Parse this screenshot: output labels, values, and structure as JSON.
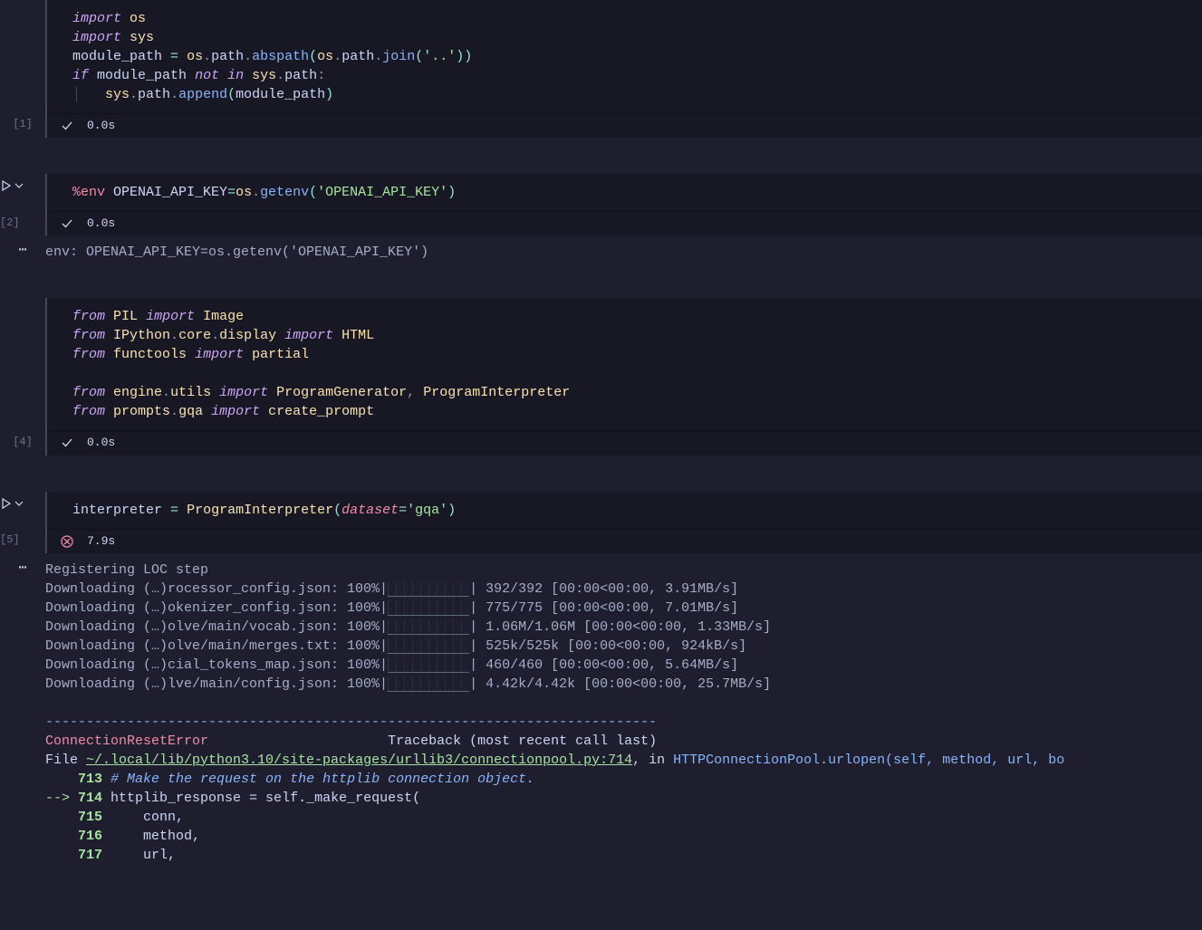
{
  "cells": [
    {
      "exec": "[1]",
      "status": "ok",
      "time": "0.0s",
      "code_html": "<span class='kw'>import</span> <span class='mod'>os</span>\n<span class='kw'>import</span> <span class='mod'>sys</span>\n<span class='var'>module_path</span> <span class='op'>=</span> <span class='mod'>os</span><span class='punc'>.</span><span class='var'>path</span><span class='punc'>.</span><span class='func'>abspath</span><span class='op'>(</span><span class='mod'>os</span><span class='punc'>.</span><span class='var'>path</span><span class='punc'>.</span><span class='func'>join</span><span class='op'>(</span><span class='str'>'..'</span><span class='op'>)</span><span class='op'>)</span>\n<span class='kw'>if</span> <span class='var'>module_path</span> <span class='kw'>not</span> <span class='kw'>in</span> <span class='mod'>sys</span><span class='punc'>.</span><span class='var'>path</span><span class='punc'>:</span>\n<span class='guide'>│   </span><span class='mod'>sys</span><span class='punc'>.</span><span class='var'>path</span><span class='punc'>.</span><span class='func'>append</span><span class='op'>(</span><span class='var'>module_path</span><span class='op'>)</span>"
    },
    {
      "exec": "[2]",
      "status": "ok",
      "time": "0.0s",
      "run_controls": true,
      "code_html": "<span class='magic'>%env</span> <span class='var'>OPENAI_API_KEY</span><span class='op'>=</span><span class='mod'>os</span><span class='punc'>.</span><span class='func'>getenv</span><span class='op'>(</span><span class='str'>'OPENAI_API_KEY'</span><span class='op'>)</span>",
      "output": "env: OPENAI_API_KEY=os.getenv('OPENAI_API_KEY')"
    },
    {
      "exec": "[4]",
      "status": "ok",
      "time": "0.0s",
      "code_html": "<span class='kw'>from</span> <span class='mod'>PIL</span> <span class='kw'>import</span> <span class='mod'>Image</span>\n<span class='kw'>from</span> <span class='mod'>IPython</span><span class='punc'>.</span><span class='mod'>core</span><span class='punc'>.</span><span class='mod'>display</span> <span class='kw'>import</span> <span class='mod'>HTML</span>\n<span class='kw'>from</span> <span class='mod'>functools</span> <span class='kw'>import</span> <span class='mod'>partial</span>\n\n<span class='kw'>from</span> <span class='mod'>engine</span><span class='punc'>.</span><span class='mod'>utils</span> <span class='kw'>import</span> <span class='mod'>ProgramGenerator</span><span class='punc'>,</span> <span class='mod'>ProgramInterpreter</span>\n<span class='kw'>from</span> <span class='mod'>prompts</span><span class='punc'>.</span><span class='mod'>gqa</span> <span class='kw'>import</span> <span class='mod'>create_prompt</span>"
    },
    {
      "exec": "[5]",
      "status": "err",
      "time": "7.9s",
      "run_controls": true,
      "code_html": "<span class='var'>interpreter</span> <span class='op'>=</span> <span class='cls'>ProgramInterpreter</span><span class='op'>(</span><span class='param'>dataset</span><span class='op'>=</span><span class='str'>'gqa'</span><span class='op'>)</span>",
      "output_rich": true
    }
  ],
  "cell5_output": {
    "registering": "Registering LOC step",
    "downloads": [
      "Downloading (…)rocessor_config.json: 100%|██████████| 392/392 [00:00<00:00, 3.91MB/s]",
      "Downloading (…)okenizer_config.json: 100%|██████████| 775/775 [00:00<00:00, 7.01MB/s]",
      "Downloading (…)olve/main/vocab.json: 100%|██████████| 1.06M/1.06M [00:00<00:00, 1.33MB/s]",
      "Downloading (…)olve/main/merges.txt: 100%|██████████| 525k/525k [00:00<00:00, 924kB/s]",
      "Downloading (…)cial_tokens_map.json: 100%|██████████| 460/460 [00:00<00:00, 5.64MB/s]",
      "Downloading (…)lve/main/config.json: 100%|██████████| 4.42k/4.42k [00:00<00:00, 25.7MB/s]"
    ],
    "tb_dash": "---------------------------------------------------------------------------",
    "tb_error": "ConnectionResetError",
    "tb_header_rest": "                      Traceback (most recent call last)",
    "tb_file_prefix": "File ",
    "tb_file_path": "~/.local/lib/python3.10/site-packages/urllib3/connectionpool.py:714",
    "tb_file_suffix": ", in ",
    "tb_call": "HTTPConnectionPool.urlopen(self, method, url, bo",
    "tb_lines": [
      {
        "no": "713",
        "prefix": "    ",
        "text": " # Make the request on the httplib connection object.",
        "comment": true
      },
      {
        "no": "714",
        "prefix": "--> ",
        "text": " httplib_response = self._make_request(",
        "arrow": true
      },
      {
        "no": "715",
        "prefix": "    ",
        "text": "     conn,"
      },
      {
        "no": "716",
        "prefix": "    ",
        "text": "     method,"
      },
      {
        "no": "717",
        "prefix": "    ",
        "text": "     url,"
      }
    ]
  },
  "chart_data": {
    "type": "bar",
    "note": "Download progress bars (all 100%)",
    "categories": [
      "rocessor_config.json",
      "okenizer_config.json",
      "vocab.json",
      "merges.txt",
      "special_tokens_map.json",
      "config.json"
    ],
    "values": [
      100,
      100,
      100,
      100,
      100,
      100
    ],
    "sizes": [
      "392/392",
      "775/775",
      "1.06M/1.06M",
      "525k/525k",
      "460/460",
      "4.42k/4.42k"
    ],
    "rates": [
      "3.91MB/s",
      "7.01MB/s",
      "1.33MB/s",
      "924kB/s",
      "5.64MB/s",
      "25.7MB/s"
    ],
    "ylim": [
      0,
      100
    ]
  }
}
